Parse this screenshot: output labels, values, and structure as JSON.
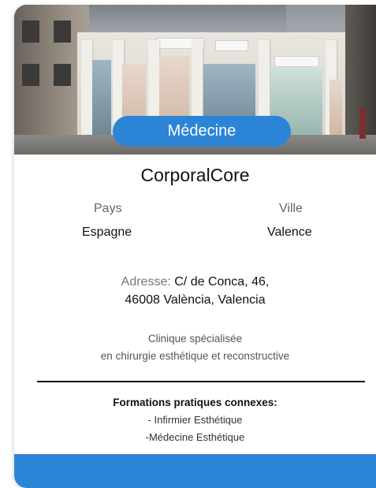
{
  "card": {
    "category_badge": "Médecine",
    "name": "CorporalCore",
    "country_label": "Pays",
    "country_value": "Espagne",
    "city_label": "Ville",
    "city_value": "Valence",
    "address_label": "Adresse:",
    "address_line1": "C/ de Conca, 46,",
    "address_line2": "46008 València, Valencia",
    "description_line1": "Clinique spécialisée",
    "description_line2": "en chirurgie esthétique et reconstructive",
    "trainings_title": "Formations pratiques connexes:",
    "trainings": [
      "- Infirmier Esthétique",
      "-Médecine Esthétique"
    ]
  },
  "colors": {
    "accent": "#2b84d6"
  }
}
